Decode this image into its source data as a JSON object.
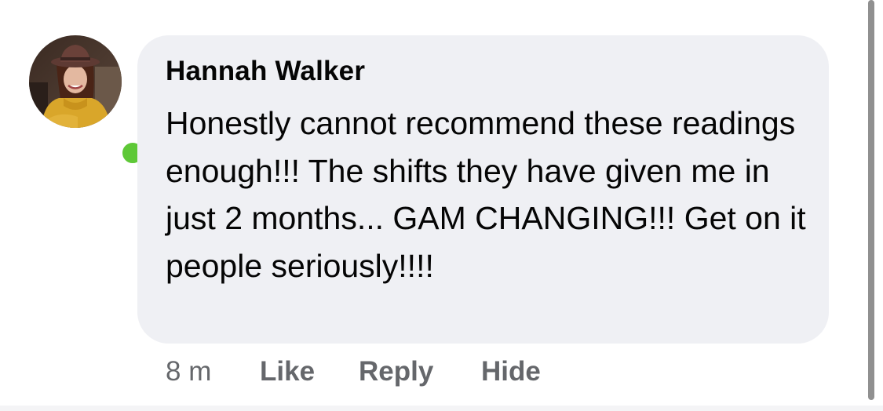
{
  "comment": {
    "author": "Hannah Walker",
    "body": "Honestly cannot recommend these readings enough!!! The shifts they have given me in just 2 months... GAM CHANGING!!! Get on it people seriously!!!!",
    "timestamp": "8 m",
    "actions": {
      "like": "Like",
      "reply": "Reply",
      "hide": "Hide"
    },
    "avatar_icon": "user-photo",
    "online": true
  },
  "colors": {
    "bubble": "#eff0f4",
    "text": "#050505",
    "secondary_text": "#65676b",
    "online_dot": "#5ec837",
    "scrollbar": "#909090"
  }
}
